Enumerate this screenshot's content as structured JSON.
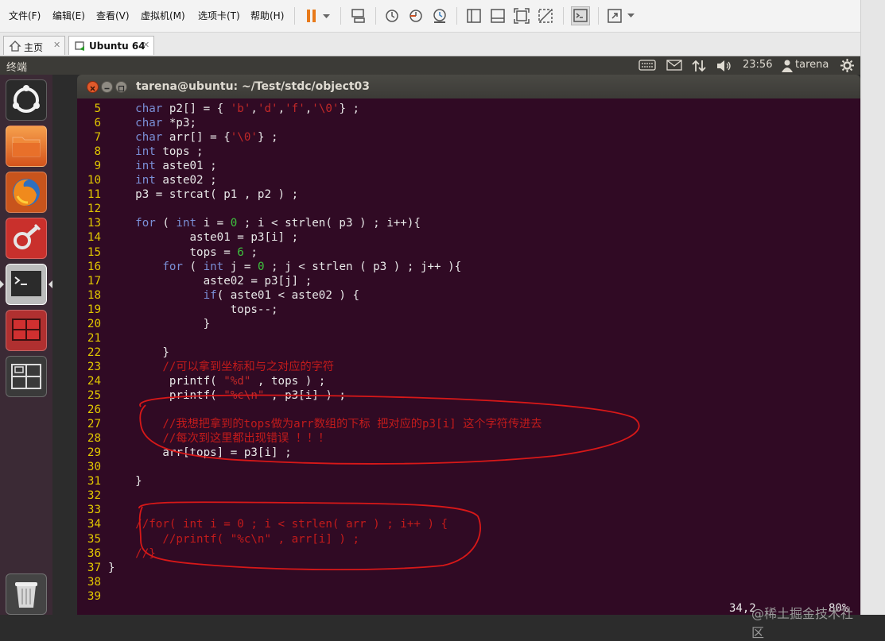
{
  "menubar": {
    "items": [
      "文件(F)",
      "编辑(E)",
      "查看(V)",
      "虚拟机(M)",
      "选项卡(T)",
      "帮助(H)"
    ]
  },
  "tabs": [
    {
      "label": "主页"
    },
    {
      "label": "Ubuntu 64"
    }
  ],
  "panel": {
    "title": "终端",
    "clock": "23:56",
    "user": "tarena"
  },
  "terminal": {
    "title": "tarena@ubuntu: ~/Test/stdc/object03",
    "status_position": "34,2",
    "status_percent": "80%"
  },
  "watermark": "@稀土掘金技术社区",
  "code_lines": [
    {
      "n": "5",
      "segs": [
        [
          "    ",
          ""
        ],
        [
          "char",
          "kw"
        ],
        [
          " p2[] = { ",
          ""
        ],
        [
          "'b'",
          "str"
        ],
        [
          ",",
          ""
        ],
        [
          "'d'",
          "str"
        ],
        [
          ",",
          ""
        ],
        [
          "'f'",
          "str"
        ],
        [
          ",",
          ""
        ],
        [
          "'\\0'",
          "str"
        ],
        [
          "} ;",
          ""
        ]
      ]
    },
    {
      "n": "6",
      "segs": [
        [
          "    ",
          ""
        ],
        [
          "char",
          "kw"
        ],
        [
          " *p3;",
          ""
        ]
      ]
    },
    {
      "n": "7",
      "segs": [
        [
          "    ",
          ""
        ],
        [
          "char",
          "kw"
        ],
        [
          " arr[] = {",
          ""
        ],
        [
          "'\\0'",
          "str"
        ],
        [
          "} ;",
          ""
        ]
      ]
    },
    {
      "n": "8",
      "segs": [
        [
          "    ",
          ""
        ],
        [
          "int",
          "kw"
        ],
        [
          " tops ;",
          ""
        ]
      ]
    },
    {
      "n": "9",
      "segs": [
        [
          "    ",
          ""
        ],
        [
          "int",
          "kw"
        ],
        [
          " aste01 ;",
          ""
        ]
      ]
    },
    {
      "n": "10",
      "segs": [
        [
          "    ",
          ""
        ],
        [
          "int",
          "kw"
        ],
        [
          " aste02 ;",
          ""
        ]
      ]
    },
    {
      "n": "11",
      "segs": [
        [
          "    p3 = strcat( p1 , p2 ) ;",
          ""
        ]
      ]
    },
    {
      "n": "12",
      "segs": []
    },
    {
      "n": "13",
      "segs": [
        [
          "    ",
          ""
        ],
        [
          "for",
          "kw"
        ],
        [
          " ( ",
          ""
        ],
        [
          "int",
          "kw"
        ],
        [
          " i = ",
          ""
        ],
        [
          "0",
          "num"
        ],
        [
          " ; i < strlen( p3 ) ; i++){",
          ""
        ]
      ]
    },
    {
      "n": "14",
      "segs": [
        [
          "            aste01 = p3[i] ;",
          ""
        ]
      ]
    },
    {
      "n": "15",
      "segs": [
        [
          "            tops = ",
          ""
        ],
        [
          "6",
          "num"
        ],
        [
          " ;",
          ""
        ]
      ]
    },
    {
      "n": "16",
      "segs": [
        [
          "        ",
          ""
        ],
        [
          "for",
          "kw"
        ],
        [
          " ( ",
          ""
        ],
        [
          "int",
          "kw"
        ],
        [
          " j = ",
          ""
        ],
        [
          "0",
          "num"
        ],
        [
          " ; j < strlen ( p3 ) ; j++ ){",
          ""
        ]
      ]
    },
    {
      "n": "17",
      "segs": [
        [
          "              aste02 = p3[j] ;",
          ""
        ]
      ]
    },
    {
      "n": "18",
      "segs": [
        [
          "              ",
          ""
        ],
        [
          "if",
          "kw"
        ],
        [
          "( aste01 < aste02 ) {",
          ""
        ]
      ]
    },
    {
      "n": "19",
      "segs": [
        [
          "                  tops--;",
          ""
        ]
      ]
    },
    {
      "n": "20",
      "segs": [
        [
          "              }",
          ""
        ]
      ]
    },
    {
      "n": "21",
      "segs": []
    },
    {
      "n": "22",
      "segs": [
        [
          "        }",
          ""
        ]
      ]
    },
    {
      "n": "23",
      "segs": [
        [
          "        ",
          ""
        ],
        [
          "//可以拿到坐标和与之对应的字符",
          "cmt"
        ]
      ]
    },
    {
      "n": "24",
      "segs": [
        [
          "         printf( ",
          ""
        ],
        [
          "\"%d\"",
          "str"
        ],
        [
          " , tops ) ;",
          ""
        ]
      ]
    },
    {
      "n": "25",
      "segs": [
        [
          "         printf( ",
          ""
        ],
        [
          "\"%c\\n\"",
          "str"
        ],
        [
          " , p3[i] ) ;",
          ""
        ]
      ]
    },
    {
      "n": "26",
      "segs": []
    },
    {
      "n": "27",
      "segs": [
        [
          "        ",
          ""
        ],
        [
          "//我想把拿到的tops做为arr数组的下标 把对应的p3[i] 这个字符传进去",
          "cmt"
        ]
      ]
    },
    {
      "n": "28",
      "segs": [
        [
          "        ",
          ""
        ],
        [
          "//每次到这里都出现错误 ！！！",
          "cmt"
        ]
      ]
    },
    {
      "n": "29",
      "segs": [
        [
          "        arr[tops] = p3[i] ;",
          ""
        ]
      ]
    },
    {
      "n": "30",
      "segs": []
    },
    {
      "n": "31",
      "segs": [
        [
          "    }",
          ""
        ]
      ]
    },
    {
      "n": "32",
      "segs": []
    },
    {
      "n": "33",
      "segs": []
    },
    {
      "n": "34",
      "segs": [
        [
          "    ",
          ""
        ],
        [
          "//for( int i = 0 ; i < strlen( arr ) ; i++ ) {",
          "cmt"
        ]
      ]
    },
    {
      "n": "35",
      "segs": [
        [
          "        ",
          ""
        ],
        [
          "//printf( \"%c\\n\" , arr[i] ) ;",
          "cmt"
        ]
      ]
    },
    {
      "n": "36",
      "segs": [
        [
          "    ",
          ""
        ],
        [
          "//}",
          "cmt"
        ]
      ]
    },
    {
      "n": "37",
      "segs": [
        [
          "}",
          ""
        ]
      ]
    },
    {
      "n": "38",
      "segs": []
    },
    {
      "n": "39",
      "segs": []
    }
  ]
}
